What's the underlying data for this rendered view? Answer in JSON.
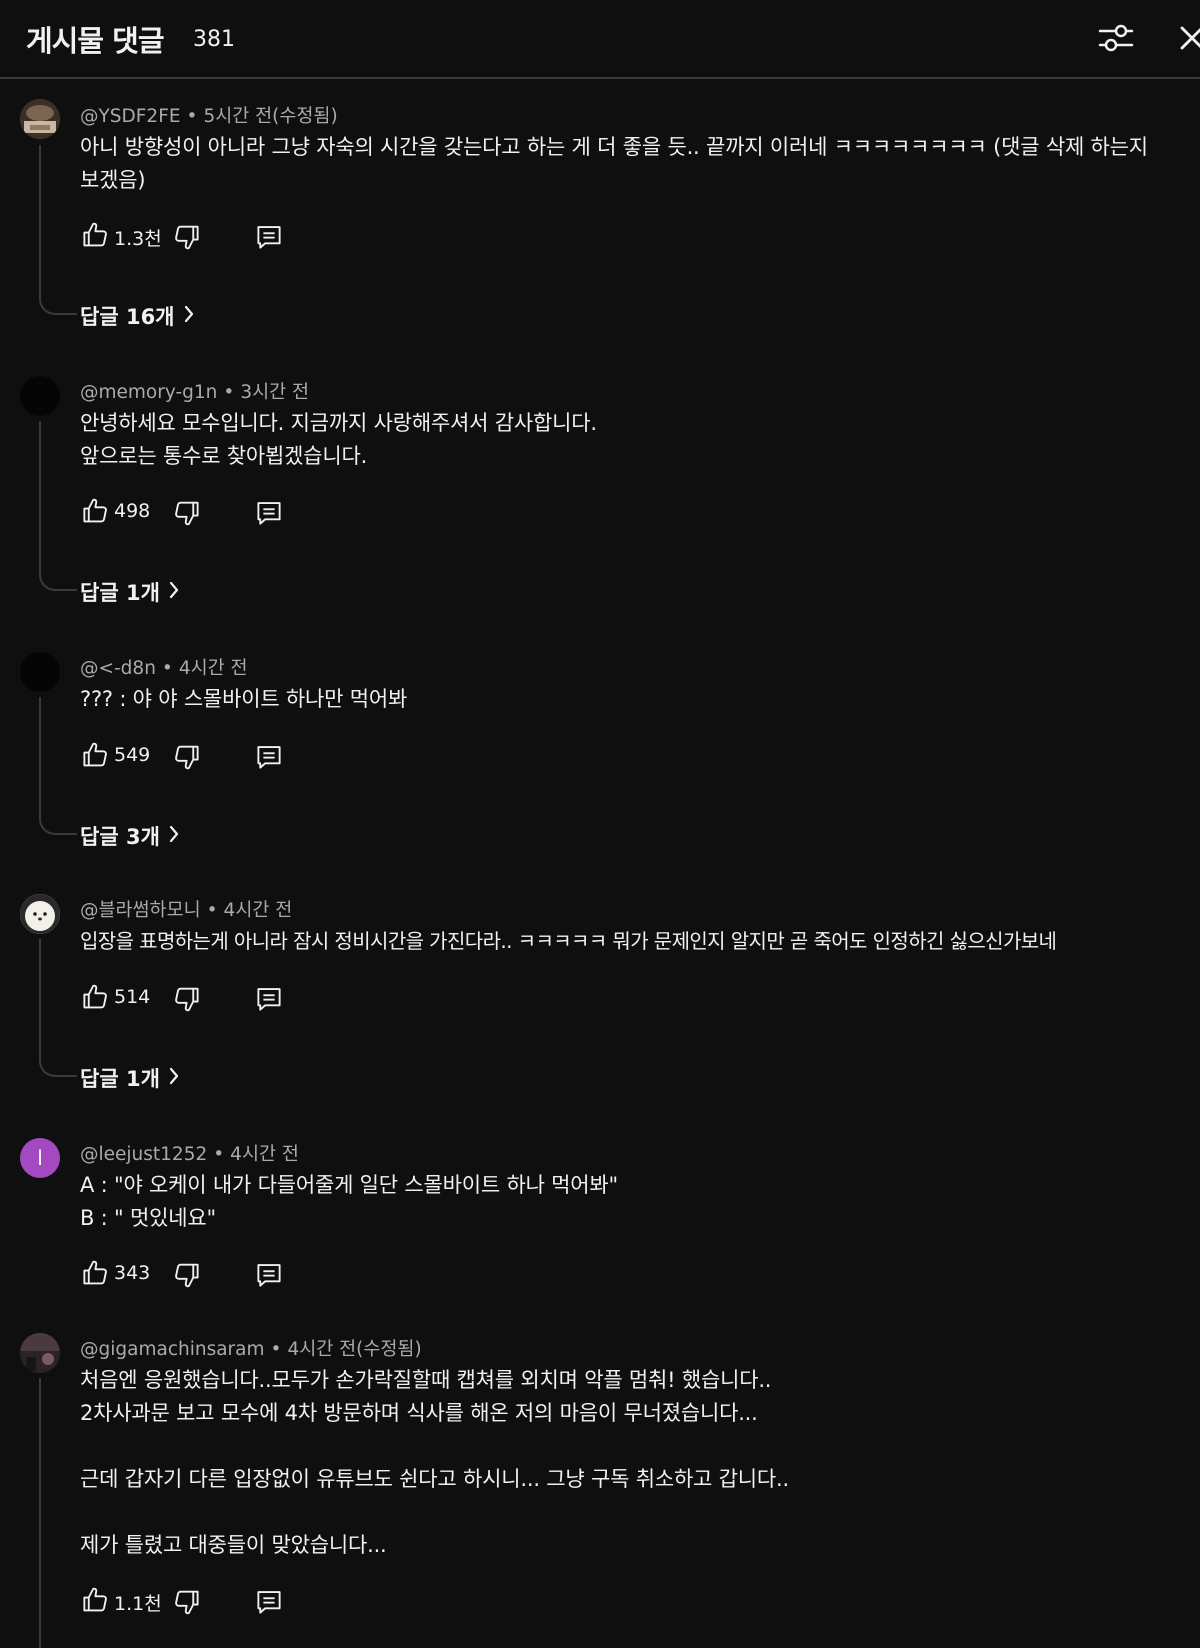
{
  "header": {
    "title": "게시물 댓글",
    "count": "381"
  },
  "comments": [
    {
      "author": "@YSDF2FE",
      "time": "5시간 전(수정됨)",
      "text": "아니 방향성이 아니라 그냥 자숙의 시간을 갖는다고 하는 게 더 좋을 듯.. 끝까지 이러네 ㅋㅋㅋㅋㅋㅋㅋㅋ (댓글 삭제 하는지 보겠음)",
      "likes": "1.3천",
      "replies": "답글 16개"
    },
    {
      "author": "@memory-g1n",
      "time": "3시간 전",
      "text": "안녕하세요 모수입니다. 지금까지 사랑해주셔서 감사합니다.\n앞으로는 통수로 찾아뵙겠습니다.",
      "likes": "498",
      "replies": "답글 1개"
    },
    {
      "author": "@<-d8n",
      "time": "4시간 전",
      "text": "??? : 야 야 스몰바이트 하나만 먹어봐",
      "likes": "549",
      "replies": "답글 3개"
    },
    {
      "author": "@블라썸하모니",
      "time": "4시간 전",
      "text": "입장을 표명하는게 아니라 잠시 정비시간을 가진다라.. ㅋㅋㅋㅋㅋ 뭐가 문제인지 알지만 곧 죽어도 인정하긴 싫으신가보네",
      "likes": "514",
      "replies": "답글 1개"
    },
    {
      "author": "@leejust1252",
      "time": "4시간 전",
      "avatar_letter": "l",
      "text": "A : \"야 오케이 내가 다들어줄게 일단 스몰바이트 하나 먹어봐\"\nB : \" 멋있네요\"",
      "likes": "343"
    },
    {
      "author": "@gigamachinsaram",
      "time": "4시간 전(수정됨)",
      "text": "처음엔 응원했습니다..모두가 손가락질할때 캡쳐를 외치며 악플 멈춰! 했습니다..\n2차사과문 보고 모수에 4차 방문하며 식사를 해온 저의 마음이 무너졌습니다...\n\n근데 갑자기 다른 입장없이 유튜브도 쉰다고 하시니... 그냥 구독 취소하고 갑니다..\n\n제가 틀렸고 대중들이 맞았습니다...",
      "likes": "1.1천"
    }
  ],
  "colors": {
    "background": "#0f0f0f",
    "text": "#f1f1f1",
    "meta": "#aaaaaa",
    "divider": "#3a3a3a",
    "avatar_purple": "#a44ac1"
  },
  "icons": {
    "filter": "sliders-icon",
    "close": "close-icon",
    "like": "thumb-up-icon",
    "dislike": "thumb-down-icon",
    "reply": "comment-icon",
    "replies_chevron": "chevron-right-icon"
  }
}
